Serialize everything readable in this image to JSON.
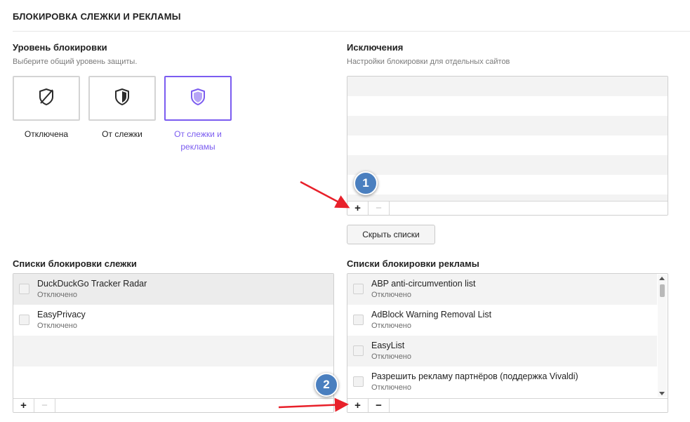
{
  "section": {
    "title": "БЛОКИРОВКА СЛЕЖКИ И РЕКЛАМЫ"
  },
  "level": {
    "heading": "Уровень блокировки",
    "subtext": "Выберите общий уровень защиты.",
    "options": [
      {
        "label": "Отключена",
        "icon": "shield-off-icon",
        "selected": false
      },
      {
        "label": "От слежки",
        "icon": "shield-half-icon",
        "selected": false
      },
      {
        "label": "От слежки и рекламы",
        "icon": "shield-full-icon",
        "selected": true
      }
    ]
  },
  "exceptions": {
    "heading": "Исключения",
    "subtext": "Настройки блокировки для отдельных сайтов",
    "add_label": "+",
    "remove_label": "−",
    "hide_lists_button": "Скрыть списки"
  },
  "tracker_lists": {
    "heading": "Списки блокировки слежки",
    "items": [
      {
        "name": "DuckDuckGo Tracker Radar",
        "status": "Отключено",
        "checked": false
      },
      {
        "name": "EasyPrivacy",
        "status": "Отключено",
        "checked": false
      }
    ],
    "add_label": "+",
    "remove_label": "−"
  },
  "ad_lists": {
    "heading": "Списки блокировки рекламы",
    "items": [
      {
        "name": "ABP anti-circumvention list",
        "status": "Отключено",
        "checked": false
      },
      {
        "name": "AdBlock Warning Removal List",
        "status": "Отключено",
        "checked": false
      },
      {
        "name": "EasyList",
        "status": "Отключено",
        "checked": false
      },
      {
        "name": "Разрешить рекламу партнёров (поддержка Vivaldi)",
        "status": "Отключено",
        "checked": false
      }
    ],
    "add_label": "+",
    "remove_label": "−"
  },
  "annotations": {
    "badge1": "1",
    "badge2": "2"
  },
  "colors": {
    "accent": "#7b5cf0",
    "badge": "#4a7fbf",
    "arrow": "#e8202a"
  }
}
